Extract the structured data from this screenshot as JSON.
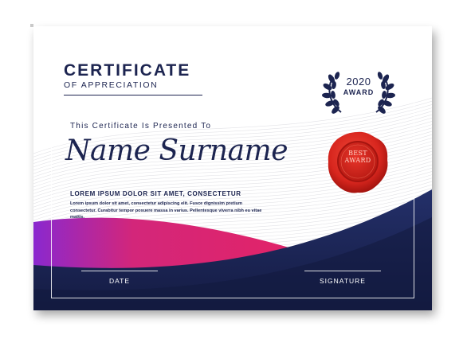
{
  "certificate": {
    "title": "CERTIFICATE",
    "subtitle": "OF APPRECIATION",
    "presented_text": "This Certificate Is Presented To",
    "name": "Name Surname",
    "lorem_heading": "LOREM IPSUM DOLOR SIT AMET, CONSECTETUR",
    "lorem_body": "Lorem ipsum dolor sit amet, consectetur adipiscing elit. Fusce dignissim pretium consectetur. Curabitur tempor posuere massa in varius. Pellentesque viverra nibh eu vitae mattis.",
    "date_label": "DATE",
    "signature_label": "SIGNATURE"
  },
  "badge": {
    "year": "2020",
    "label": "AWARD",
    "icon": "laurel-wreath-icon"
  },
  "seal": {
    "line1": "BEST",
    "line2": "AWARD",
    "icon": "wax-seal-icon"
  },
  "colors": {
    "navy": "#1c2450",
    "dark_navy": "#171f48",
    "magenta": "#e0246a",
    "purple": "#7b2ad0",
    "seal_red": "#d8261e"
  }
}
